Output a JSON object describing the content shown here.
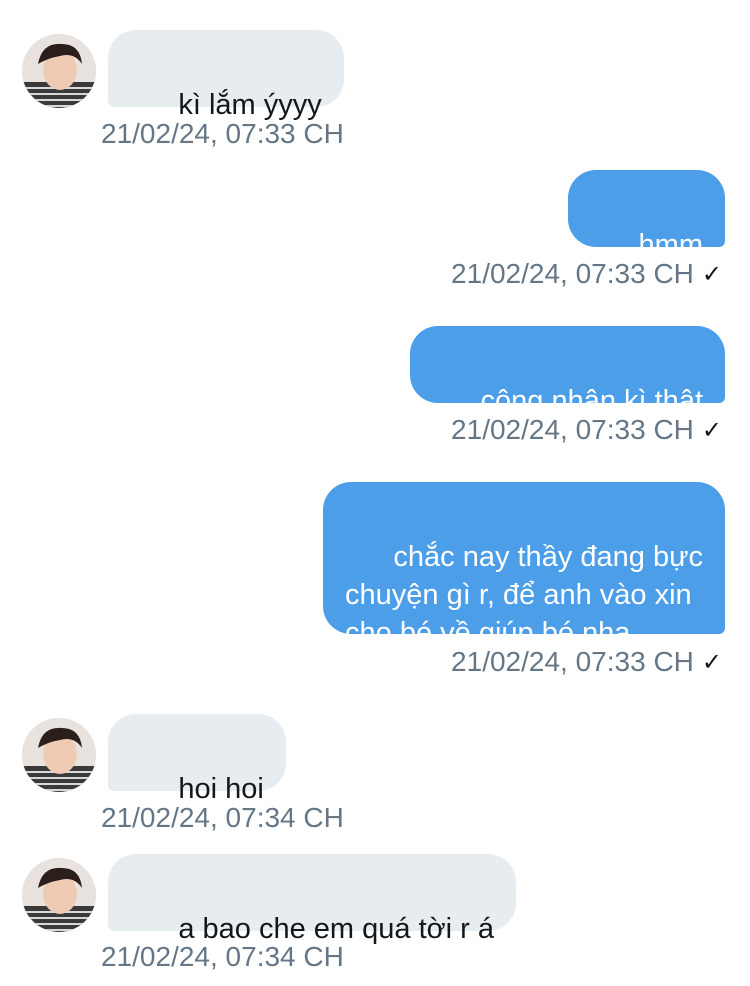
{
  "colors": {
    "incoming_bubble": "#e6ecf0",
    "outgoing_bubble": "#4d9ee9",
    "timestamp": "#657786"
  },
  "messages": [
    {
      "direction": "incoming",
      "text": "kì lắm ýyyy",
      "time": "21/02/24, 07:33 CH",
      "avatar": "user-avatar"
    },
    {
      "direction": "outgoing",
      "text": "hmm",
      "time": "21/02/24, 07:33 CH",
      "status_icon": "checkmark-icon"
    },
    {
      "direction": "outgoing",
      "text": "công nhận kì thật",
      "time": "21/02/24, 07:33 CH",
      "status_icon": "checkmark-icon"
    },
    {
      "direction": "outgoing",
      "text": "chắc nay thầy đang bực\nchuyện gì r, để anh vào xin\ncho bé về giúp bé nha",
      "time": "21/02/24, 07:33 CH",
      "status_icon": "checkmark-icon"
    },
    {
      "direction": "incoming",
      "text": "hoi hoi",
      "time": "21/02/24, 07:34 CH",
      "avatar": "user-avatar"
    },
    {
      "direction": "incoming",
      "text": "a bao che em quá tời r á",
      "time": "21/02/24, 07:34 CH",
      "avatar": "user-avatar"
    }
  ]
}
